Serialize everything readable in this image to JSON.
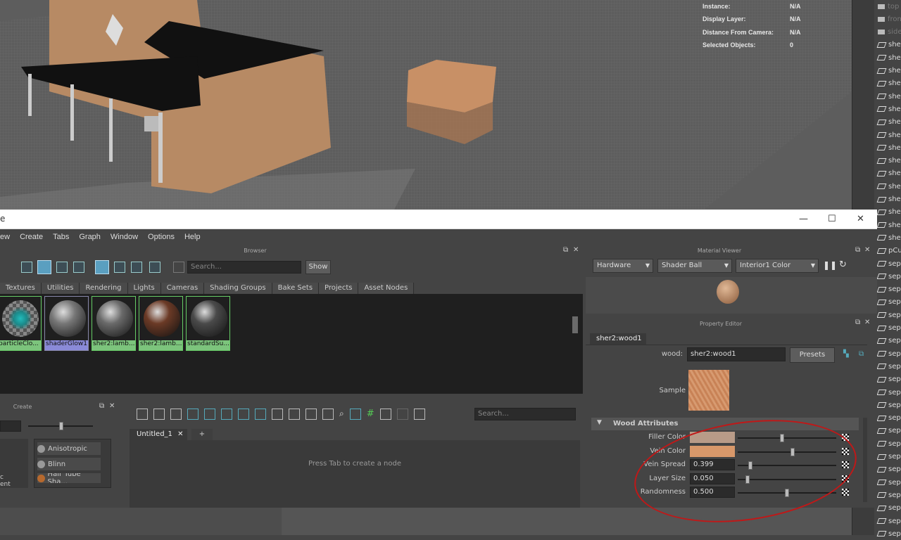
{
  "hud": [
    {
      "key": "Instance:",
      "val": "N/A"
    },
    {
      "key": "Display Layer:",
      "val": "N/A"
    },
    {
      "key": "Distance From Camera:",
      "val": "N/A"
    },
    {
      "key": "Selected Objects:",
      "val": "0"
    }
  ],
  "outliner": {
    "items": [
      "top",
      "front",
      "side",
      "she",
      "she",
      "she",
      "she",
      "she",
      "she",
      "she",
      "she",
      "she",
      "she",
      "she",
      "she",
      "she",
      "she",
      "she",
      "she",
      "pCu",
      "sep",
      "sep",
      "sep",
      "sep",
      "sep",
      "sep",
      "sep",
      "sep",
      "sep",
      "sep",
      "sep",
      "sep",
      "sep",
      "sep",
      "sep",
      "sep",
      "sep",
      "sep",
      "sep",
      "sep",
      "sep",
      "sep"
    ]
  },
  "window": {
    "title_char": "e",
    "menu": [
      "ew",
      "Create",
      "Tabs",
      "Graph",
      "Window",
      "Options",
      "Help"
    ]
  },
  "browser": {
    "title": "Browser",
    "search_placeholder": "Search...",
    "show_label": "Show",
    "tabs": [
      "Textures",
      "Utilities",
      "Rendering",
      "Lights",
      "Cameras",
      "Shading Groups",
      "Bake Sets",
      "Projects",
      "Asset Nodes"
    ],
    "swatches": [
      {
        "label": "particleClo...",
        "color": "#1b8a8a"
      },
      {
        "label": "shaderGlow1",
        "color": "#777"
      },
      {
        "label": "sher2:lamb...",
        "color": "#6a6a6a"
      },
      {
        "label": "sher2:lamb...",
        "color": "#6b3a26"
      },
      {
        "label": "standardSu...",
        "color": "#4a4a4a"
      }
    ]
  },
  "create_panel": {
    "title": "Create",
    "items": [
      "Anisotropic",
      "Blinn",
      "Hair Tube Sha..."
    ],
    "left_fragments": [
      "c",
      "ent"
    ]
  },
  "node_editor": {
    "search_placeholder": "Search...",
    "tab_label": "Untitled_1",
    "tab_add": "+",
    "hint": "Press Tab to create a node"
  },
  "material_viewer": {
    "title": "Material Viewer",
    "renderer": "Hardware",
    "shape": "Shader Ball",
    "env": "Interior1 Color"
  },
  "property_editor": {
    "title": "Property Editor",
    "tab": "sher2:wood1",
    "node_type_label": "wood:",
    "node_name": "sher2:wood1",
    "presets_label": "Presets",
    "sample_label": "Sample",
    "section_title": "Wood Attributes",
    "attributes": [
      {
        "label": "Filler Color",
        "swatch": "#b89b88",
        "slider": 0.45
      },
      {
        "label": "Vein Color",
        "swatch": "#d8986a",
        "slider": 0.56
      },
      {
        "label": "Vein Spread",
        "value": "0.399",
        "slider": 0.11
      },
      {
        "label": "Layer Size",
        "value": "0.050",
        "slider": 0.08
      },
      {
        "label": "Randomness",
        "value": "0.500",
        "slider": 0.5
      }
    ]
  },
  "colors": {
    "viewport_bg": "#5d5d5d",
    "selection_green": "#7cc47c",
    "annotation_red": "#c01818"
  }
}
